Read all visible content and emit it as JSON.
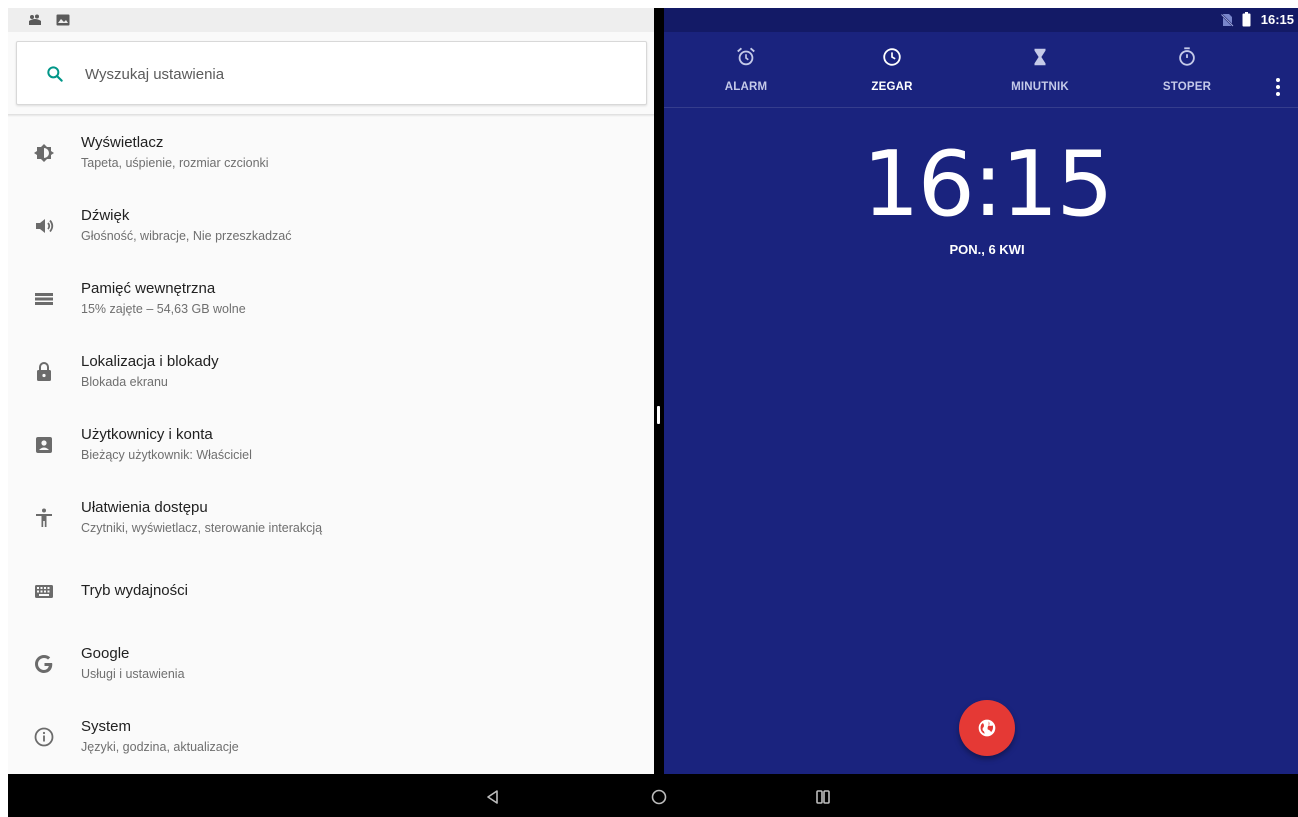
{
  "settings": {
    "search": {
      "placeholder": "Wyszukaj ustawienia"
    },
    "items": [
      {
        "icon": "brightness-icon",
        "title": "Wyświetlacz",
        "subtitle": "Tapeta, uśpienie, rozmiar czcionki"
      },
      {
        "icon": "volume-icon",
        "title": "Dźwięk",
        "subtitle": "Głośność, wibracje, Nie przeszkadzać"
      },
      {
        "icon": "storage-icon",
        "title": "Pamięć wewnętrzna",
        "subtitle": "15% zajęte – 54,63 GB wolne"
      },
      {
        "icon": "lock-icon",
        "title": "Lokalizacja i blokady",
        "subtitle": "Blokada ekranu"
      },
      {
        "icon": "account-box-icon",
        "title": "Użytkownicy i konta",
        "subtitle": "Bieżący użytkownik: Właściciel"
      },
      {
        "icon": "accessibility-icon",
        "title": "Ułatwienia dostępu",
        "subtitle": "Czytniki, wyświetlacz, sterowanie interakcją"
      },
      {
        "icon": "keyboard-icon",
        "title": "Tryb wydajności",
        "subtitle": ""
      },
      {
        "icon": "google-icon",
        "title": "Google",
        "subtitle": "Usługi i ustawienia"
      },
      {
        "icon": "info-icon",
        "title": "System",
        "subtitle": "Języki, godzina, aktualizacje"
      }
    ]
  },
  "clock": {
    "status_time": "16:15",
    "tabs": [
      {
        "icon": "alarm-icon",
        "label": "ALARM",
        "active": false
      },
      {
        "icon": "clock-icon",
        "label": "ZEGAR",
        "active": true
      },
      {
        "icon": "hourglass-icon",
        "label": "MINUTNIK",
        "active": false
      },
      {
        "icon": "stopwatch-icon",
        "label": "STOPER",
        "active": false
      }
    ],
    "time": "16:15",
    "date": "PON., 6 KWI",
    "fab_icon": "globe-icon"
  },
  "colors": {
    "clock_background": "#1a237e",
    "clock_statusbar": "#131a66",
    "fab": "#e53935",
    "search_icon": "#009688",
    "settings_background": "#fafafa"
  },
  "navbar": {
    "buttons": [
      "back-icon",
      "home-icon",
      "recents-icon"
    ]
  }
}
